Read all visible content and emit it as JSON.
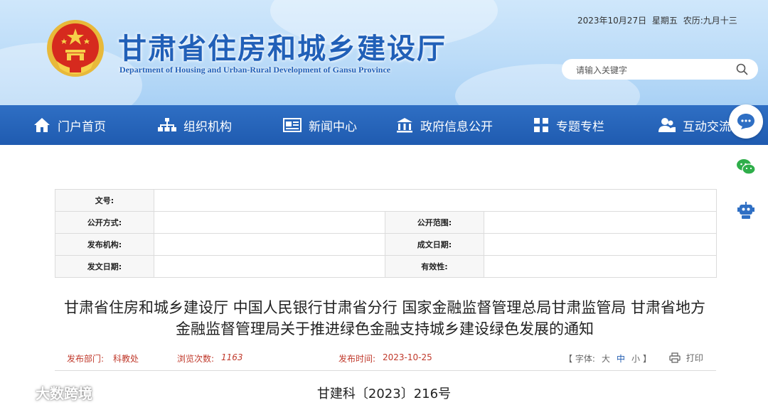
{
  "header": {
    "title": "甘肃省住房和城乡建设厅",
    "subtitle": "Department of Housing and Urban-Rural Development of Gansu Province",
    "date": "2023年10月27日",
    "weekday": "星期五",
    "lunar": "农历:九月十三",
    "search_placeholder": "请输入关键字"
  },
  "nav": {
    "items": [
      {
        "label": "门户首页",
        "icon": "home-icon"
      },
      {
        "label": "组织机构",
        "icon": "org-chart-icon"
      },
      {
        "label": "新闻中心",
        "icon": "newspaper-icon"
      },
      {
        "label": "政府信息公开",
        "icon": "government-building-icon"
      },
      {
        "label": "专题专栏",
        "icon": "grid-icon"
      },
      {
        "label": "互动交流",
        "icon": "users-icon"
      }
    ]
  },
  "floating": [
    "chat-bubble-icon",
    "wechat-icon",
    "robot-icon"
  ],
  "meta": {
    "doc_no_label": "文号:",
    "disclosure_mode_label": "公开方式:",
    "disclosure_scope_label": "公开范围:",
    "issuer_label": "发布机构:",
    "written_date_label": "成文日期:",
    "issue_date_label": "发文日期:",
    "validity_label": "有效性:"
  },
  "article": {
    "title": "甘肃省住房和城乡建设厅 中国人民银行甘肃省分行 国家金融监督管理总局甘肃监管局 甘肃省地方金融监督管理局关于推进绿色金融支持城乡建设绿色发展的通知",
    "dept_label": "发布部门:",
    "dept_value": "科教处",
    "views_label": "浏览次数:",
    "views_value": "1163",
    "time_label": "发布时间:",
    "time_value": "2023-10-25",
    "font_open": "【 字体:",
    "font_large": "大",
    "font_medium": "中",
    "font_small": "小",
    "font_close": "】",
    "print_label": "打印",
    "doc_number": "甘建科〔2023〕216号"
  },
  "watermark": "大数跨境",
  "colors": {
    "nav_blue": "#1f5bb0",
    "title_blue": "#2160b8",
    "label_red": "#c0392b"
  }
}
